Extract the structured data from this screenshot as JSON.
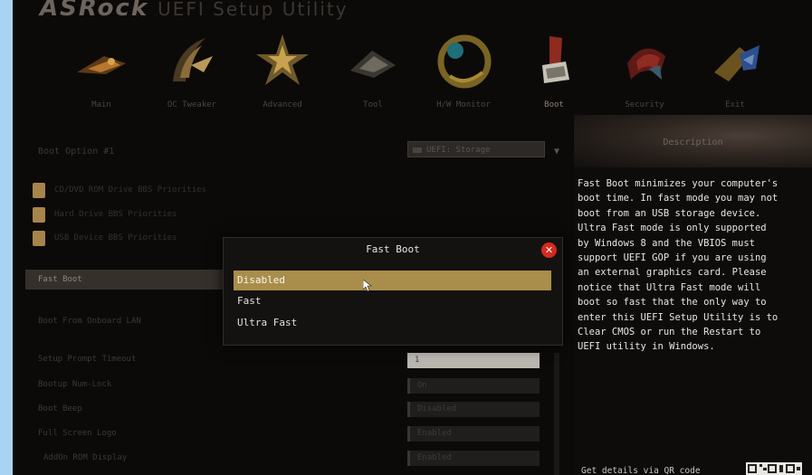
{
  "brand": {
    "name": "ASRock",
    "product": "UEFI Setup Utility"
  },
  "top_nav": [
    {
      "label": "Main",
      "icon": "main-icon"
    },
    {
      "label": "OC Tweaker",
      "icon": "oc-tweaker-icon"
    },
    {
      "label": "Advanced",
      "icon": "advanced-icon"
    },
    {
      "label": "Tool",
      "icon": "tool-icon"
    },
    {
      "label": "H/W Monitor",
      "icon": "hw-monitor-icon"
    },
    {
      "label": "Boot",
      "icon": "boot-icon",
      "active": true
    },
    {
      "label": "Security",
      "icon": "security-icon"
    },
    {
      "label": "Exit",
      "icon": "exit-icon"
    }
  ],
  "main": {
    "section_title": "Boot Option #1",
    "search_value": "UEFI: Storage",
    "folders": [
      "CD/DVD ROM Drive BBS Priorities",
      "Hard Drive BBS Priorities",
      "USB Device BBS Priorities"
    ],
    "menu_items": {
      "fast_boot": "Fast Boot",
      "boot_from_onboard_lan": "Boot From Onboard LAN",
      "setup_prompt_timeout": "Setup Prompt Timeout",
      "bootup_numlock": "Bootup Num-Lock",
      "boot_beep": "Boot Beep",
      "full_screen_logo": "Full Screen Logo",
      "addon_rom_display": "AddOn ROM Display"
    },
    "values": [
      "1",
      "On",
      "Disabled",
      "Enabled",
      "Enabled"
    ]
  },
  "dialog": {
    "title": "Fast Boot",
    "options": [
      "Disabled",
      "Fast",
      "Ultra Fast"
    ],
    "selected_index": 0
  },
  "description": {
    "title": "Description",
    "body": "Fast Boot minimizes your computer's\nboot time. In fast mode you may not\nboot from an USB storage device.\nUltra Fast mode is only supported\nby Windows 8 and the VBIOS must\nsupport UEFI GOP if you are using\nan external graphics card. Please\nnotice that Ultra Fast mode will\nboot so fast that the only way to\nenter this UEFI Setup Utility is to\nClear CMOS or run the Restart to\nUEFI utility in Windows.",
    "qr_text": "Get details via QR code"
  },
  "colors": {
    "accent_gold": "#a98d4b",
    "close_red": "#d42a1f",
    "background": "#0c0a09"
  }
}
